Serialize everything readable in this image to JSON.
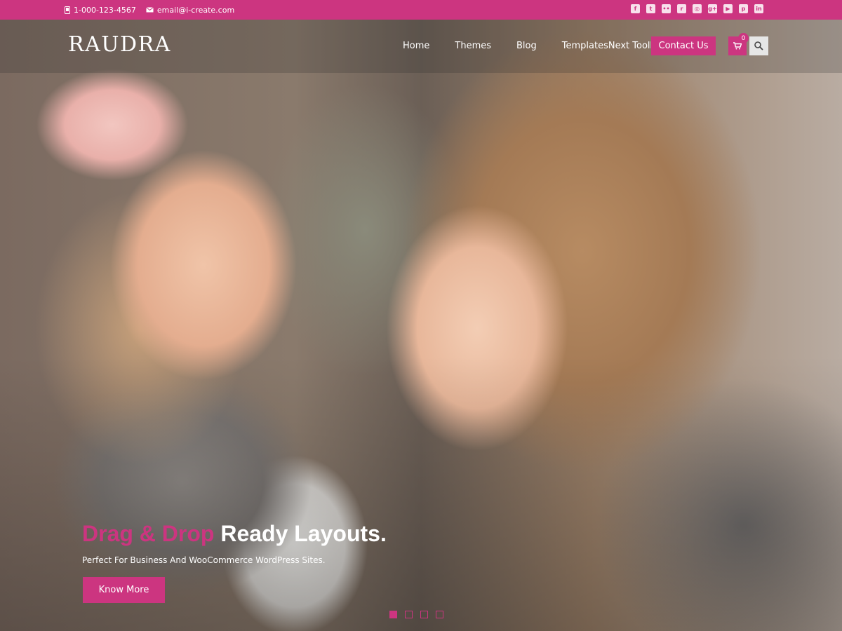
{
  "topbar": {
    "phone": "1-000-123-4567",
    "email": "email@i-create.com",
    "phone_icon": "phone-icon",
    "email_icon": "envelope-icon",
    "social": [
      {
        "name": "facebook-icon",
        "glyph": "f"
      },
      {
        "name": "twitter-icon",
        "glyph": "t"
      },
      {
        "name": "flickr-icon",
        "glyph": "••"
      },
      {
        "name": "rss-icon",
        "glyph": "r"
      },
      {
        "name": "instagram-icon",
        "glyph": "◎"
      },
      {
        "name": "google-plus-icon",
        "glyph": "g+"
      },
      {
        "name": "youtube-icon",
        "glyph": "▶"
      },
      {
        "name": "pinterest-icon",
        "glyph": "p"
      },
      {
        "name": "linkedin-icon",
        "glyph": "in"
      }
    ]
  },
  "header": {
    "logo": "RAUDRA",
    "nav": [
      "Home",
      "Themes",
      "Blog",
      "TemplatesNext Toolkit"
    ],
    "contact_label": "Contact Us",
    "cart_count": "0",
    "cart_icon": "cart-icon",
    "search_icon": "search-icon"
  },
  "hero": {
    "headline_accent": "Drag & Drop",
    "headline_rest": "Ready Layouts.",
    "subline": "Perfect For Business And WooCommerce WordPress Sites.",
    "button_label": "Know More",
    "slides": 4,
    "active_slide": 1
  },
  "colors": {
    "accent": "#cc3580",
    "white": "#ffffff"
  }
}
